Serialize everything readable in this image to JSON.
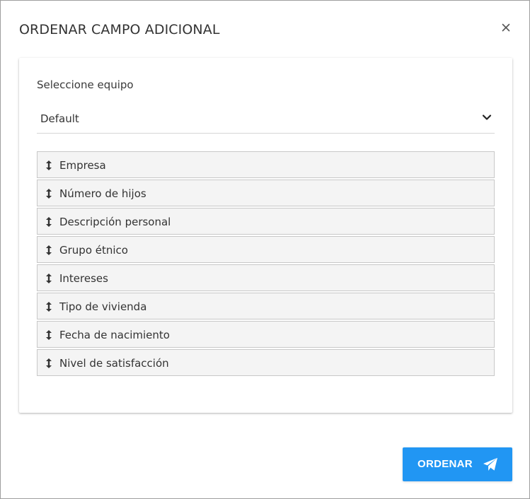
{
  "dialog": {
    "title": "ORDENAR CAMPO ADICIONAL",
    "close_icon": "close-icon"
  },
  "team_select": {
    "label": "Seleccione equipo",
    "value": "Default",
    "icon": "chevron-down-icon"
  },
  "fields": [
    {
      "label": "Empresa",
      "icon": "drag-handle-icon"
    },
    {
      "label": "Número de hijos",
      "icon": "drag-handle-icon"
    },
    {
      "label": "Descripción personal",
      "icon": "drag-handle-icon"
    },
    {
      "label": "Grupo étnico",
      "icon": "drag-handle-icon"
    },
    {
      "label": "Intereses",
      "icon": "drag-handle-icon"
    },
    {
      "label": "Tipo de vivienda",
      "icon": "drag-handle-icon"
    },
    {
      "label": "Fecha de nacimiento",
      "icon": "drag-handle-icon"
    },
    {
      "label": "Nivel de satisfacción",
      "icon": "drag-handle-icon"
    }
  ],
  "footer": {
    "order_label": "ORDENAR",
    "order_icon": "send-icon"
  },
  "colors": {
    "accent": "#2196f3",
    "item_background": "#f4f4f4",
    "item_border": "#c8c8c8",
    "text": "#333333"
  }
}
